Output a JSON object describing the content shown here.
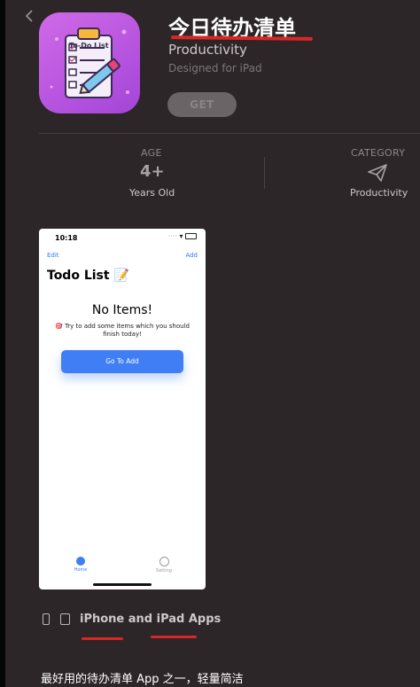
{
  "app": {
    "title": "今日待办清单",
    "category": "Productivity",
    "designed_for": "Designed for iPad",
    "get_label": "GET",
    "icon_text": "To-Do List"
  },
  "info": {
    "age": {
      "label": "AGE",
      "value": "4+",
      "sub": "Years Old"
    },
    "category": {
      "label": "CATEGORY",
      "icon": "paper-plane-icon",
      "sub": "Productivity"
    }
  },
  "screenshot": {
    "time": "10:18",
    "edit": "Edit",
    "add": "Add",
    "title": "Todo List 📝",
    "empty_title": "No Items!",
    "hint": "🎯 Try to add some items which you should finish today!",
    "button": "Go To Add",
    "tabs": [
      {
        "label": "Home",
        "icon": "home-icon"
      },
      {
        "label": "Setting",
        "icon": "play-circle-icon"
      }
    ]
  },
  "compat": {
    "text": "iPhone and iPad Apps",
    "icons": [
      "iphone-icon",
      "ipad-icon"
    ]
  },
  "description": "最好用的待办清单 App 之一，轻量简洁",
  "colors": {
    "background": "#2d2628",
    "accent_blue": "#3f7ef5",
    "annotation_red": "#d92626",
    "icon_purple": "#b957e3"
  }
}
